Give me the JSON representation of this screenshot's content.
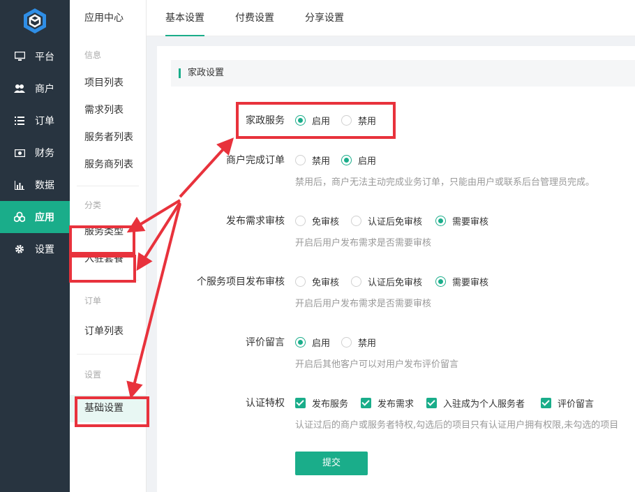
{
  "nav": {
    "items": [
      {
        "label": "平台",
        "icon": "monitor-icon"
      },
      {
        "label": "商户",
        "icon": "users-icon"
      },
      {
        "label": "订单",
        "icon": "list-icon"
      },
      {
        "label": "财务",
        "icon": "money-icon"
      },
      {
        "label": "数据",
        "icon": "bar-chart-icon"
      },
      {
        "label": "应用",
        "icon": "apps-icon",
        "active": true
      },
      {
        "label": "设置",
        "icon": "gear-icon"
      }
    ]
  },
  "subnav": {
    "title": "应用中心",
    "groups": [
      {
        "head": "信息",
        "items": [
          "项目列表",
          "需求列表",
          "服务者列表",
          "服务商列表"
        ]
      },
      {
        "head": "分类",
        "items": [
          "服务类型",
          "入驻套餐"
        ]
      },
      {
        "head": "订单",
        "items": [
          "订单列表"
        ]
      },
      {
        "head": "设置",
        "items": [
          "基础设置"
        ]
      }
    ]
  },
  "tabs": [
    "基本设置",
    "付费设置",
    "分享设置"
  ],
  "section": {
    "title": "家政设置"
  },
  "form": {
    "housekeeping": {
      "label": "家政服务",
      "opt1": "启用",
      "opt2": "禁用"
    },
    "merchant_complete": {
      "label": "商户完成订单",
      "opt1": "禁用",
      "opt2": "启用",
      "hint": "禁用后，商户无法主动完成业务订单，只能由用户或联系后台管理员完成。"
    },
    "demand_review": {
      "label": "发布需求审核",
      "opt1": "免审核",
      "opt2": "认证后免审核",
      "opt3": "需要审核",
      "hint": "开启后用户发布需求是否需要审核"
    },
    "personal_review": {
      "label": "个服务项目发布审核",
      "opt1": "免审核",
      "opt2": "认证后免审核",
      "opt3": "需要审核",
      "hint": "开启后用户发布需求是否需要审核"
    },
    "comment": {
      "label": "评价留言",
      "opt1": "启用",
      "opt2": "禁用",
      "hint": "开启后其他客户可以对用户发布评价留言"
    },
    "cert": {
      "label": "认证特权",
      "c1": "发布服务",
      "c2": "发布需求",
      "c3": "入驻成为个人服务者",
      "c4": "评价留言",
      "hint": "认证过后的商户或服务者特权,勾选后的项目只有认证用户拥有权限,未勾选的项目"
    },
    "submit": "提交"
  },
  "colors": {
    "accent": "#1aad8a",
    "sidebar": "#283440",
    "annotation": "#e8323c"
  }
}
